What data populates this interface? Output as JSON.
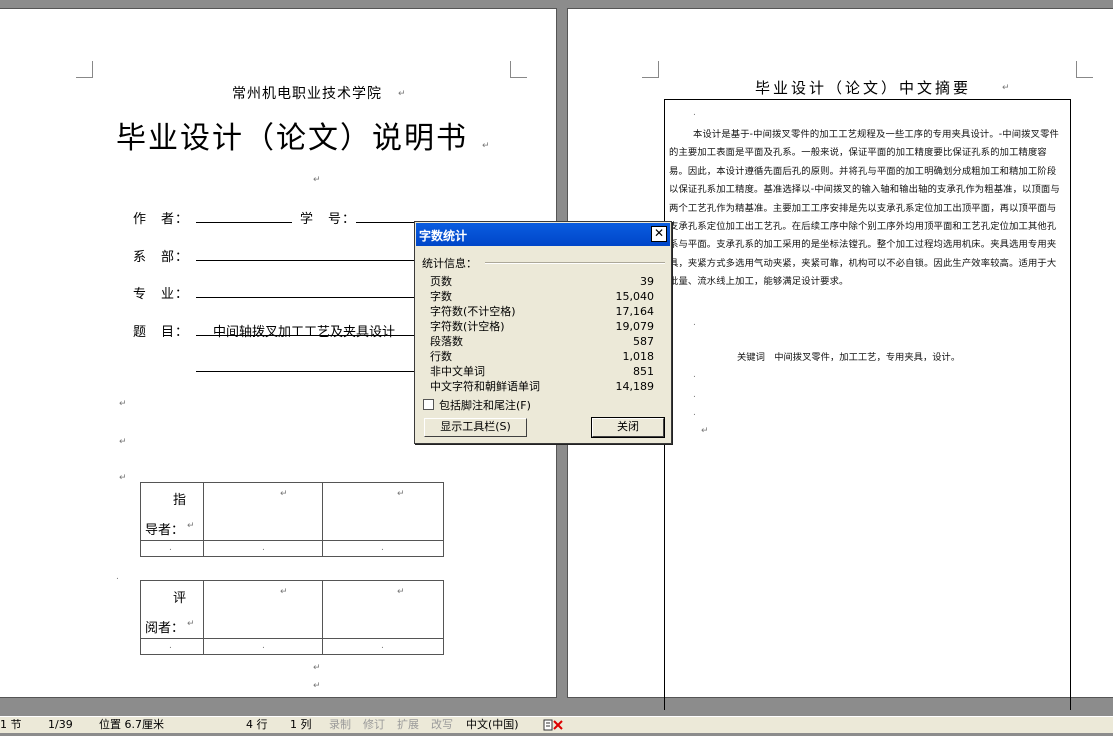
{
  "left_page": {
    "school": "常州机电职业技术学院",
    "title": "毕业设计（论文）说明书",
    "author_label": "作　者：",
    "student_id_label": "学　号：",
    "dept_label": "系　部：",
    "major_label": "专　业：",
    "topic_label": "题　目：",
    "topic_value": "中间轴拨叉加工工艺及夹具设计",
    "advisor_label_1": "指",
    "advisor_label_2": "导者：",
    "reviewer_label_1": "评",
    "reviewer_label_2": "阅者："
  },
  "right_page": {
    "abstract_title": "毕业设计（论文）中文摘要",
    "abstract_body": "本设计是基于-中间拨叉零件的加工工艺规程及一些工序的专用夹具设计。-中间拨叉零件的主要加工表面是平面及孔系。一般来说，保证平面的加工精度要比保证孔系的加工精度容易。因此，本设计遵循先面后孔的原则。并将孔与平面的加工明确划分成粗加工和精加工阶段以保证孔系加工精度。基准选择以-中间拨叉的输入轴和输出轴的支承孔作为粗基准，以顶面与两个工艺孔作为精基准。主要加工工序安排是先以支承孔系定位加工出顶平面，再以顶平面与支承孔系定位加工出工艺孔。在后续工序中除个别工序外均用顶平面和工艺孔定位加工其他孔系与平面。支承孔系的加工采用的是坐标法镗孔。整个加工过程均选用机床。夹具选用专用夹具，夹紧方式多选用气动夹紧，夹紧可靠，机构可以不必自锁。因此生产效率较高。适用于大批量、流水线上加工，能够满足设计要求。",
    "keywords": "关键词　中间拨叉零件，加工工艺，专用夹具，设计。"
  },
  "dialog": {
    "title": "字数统计",
    "close_glyph": "✕",
    "section_label": "统计信息：",
    "stats": [
      {
        "label": "页数",
        "value": "39"
      },
      {
        "label": "字数",
        "value": "15,040"
      },
      {
        "label": "字符数(不计空格)",
        "value": "17,164"
      },
      {
        "label": "字符数(计空格)",
        "value": "19,079"
      },
      {
        "label": "段落数",
        "value": "587"
      },
      {
        "label": "行数",
        "value": "1,018"
      },
      {
        "label": "非中文单词",
        "value": "851"
      },
      {
        "label": "中文字符和朝鲜语单词",
        "value": "14,189"
      }
    ],
    "checkbox_label": "包括脚注和尾注(F)",
    "toolbar_button": "显示工具栏(S)",
    "close_button": "关闭"
  },
  "statusbar": {
    "section": "1 节",
    "page": "1/39",
    "position": "位置 6.7厘米",
    "line": "4 行",
    "column": "1 列",
    "rec": "录制",
    "trk": "修订",
    "ext": "扩展",
    "ovr": "改写",
    "language": "中文(中国)"
  },
  "colors": {
    "titlebar": "#0a5de0",
    "dialog_bg": "#ece9d8",
    "workspace": "#8c8c8c"
  }
}
